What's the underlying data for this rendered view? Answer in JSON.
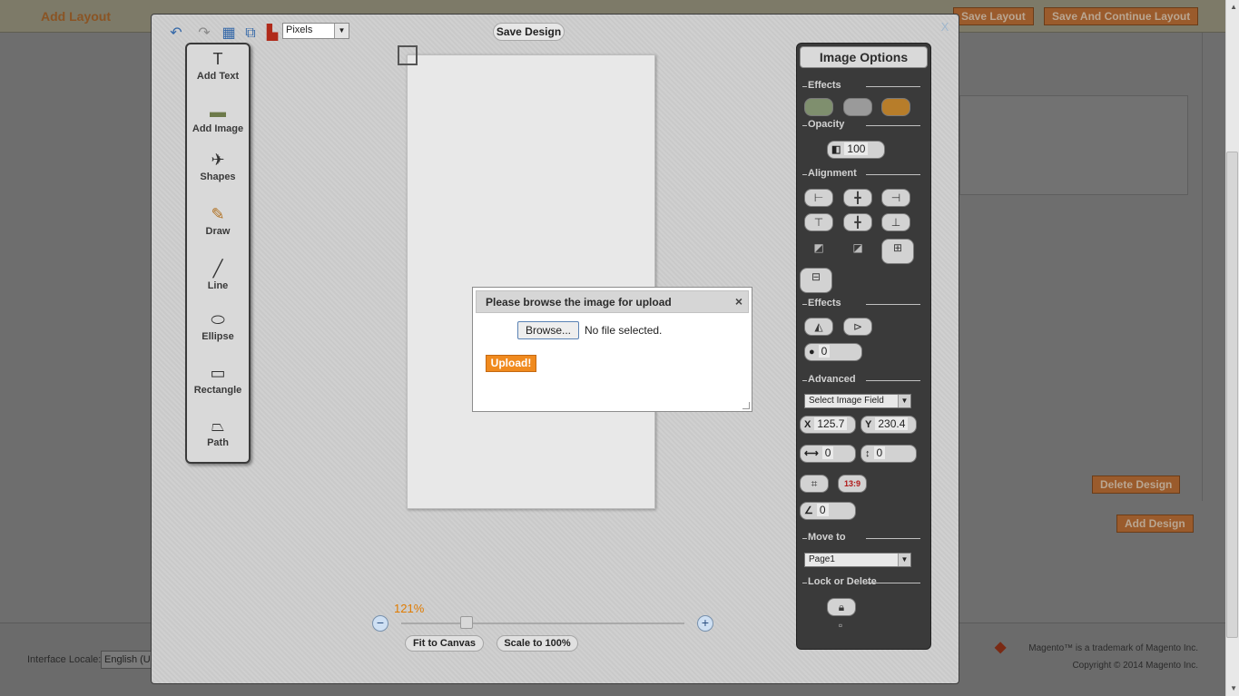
{
  "background": {
    "page_title": "Add Layout",
    "header_buttons": [
      "Save Layout",
      "Save And Continue Layout"
    ],
    "delete_design": "Delete Design",
    "add_design": "Add Design",
    "locale_label": "Interface Locale:",
    "locale_value": "English (U",
    "trademark": "Magento™ is a trademark of Magento Inc.",
    "copyright": "Copyright © 2014 Magento Inc."
  },
  "designer": {
    "close_label": "X",
    "unit_select": "Pixels",
    "save_design": "Save Design",
    "tools": [
      {
        "label": "Add Text",
        "icon": "text-tool-icon",
        "glyph": "T"
      },
      {
        "label": "Add Image",
        "icon": "image-tool-icon",
        "glyph": "▬"
      },
      {
        "label": "Shapes",
        "icon": "shapes-tool-icon",
        "glyph": "✈"
      },
      {
        "label": "Draw",
        "icon": "pencil-icon",
        "glyph": "✎"
      },
      {
        "label": "Line",
        "icon": "line-icon",
        "glyph": "╱"
      },
      {
        "label": "Ellipse",
        "icon": "ellipse-icon",
        "glyph": "⬭"
      },
      {
        "label": "Rectangle",
        "icon": "rectangle-icon",
        "glyph": "▭"
      },
      {
        "label": "Path",
        "icon": "path-icon",
        "glyph": "⏢"
      }
    ],
    "zoom": {
      "percent": "121%",
      "fit_label": "Fit to Canvas",
      "scale_label": "Scale to 100%"
    }
  },
  "options": {
    "title": "Image Options",
    "sections": {
      "effects": "Effects",
      "opacity": "Opacity",
      "alignment": "Alignment",
      "effects2": "Effects",
      "advanced": "Advanced",
      "move_to": "Move to",
      "lock_delete": "Lock or Delete"
    },
    "opacity_value": "100",
    "blur_value": "0",
    "image_field_select": "Select Image Field",
    "x_label": "X",
    "x_value": "125.7",
    "y_label": "Y",
    "y_value": "230.4",
    "width_value": "0",
    "height_value": "0",
    "ratio_label": "13:9",
    "angle_value": "0",
    "page_select": "Page1"
  },
  "upload": {
    "title": "Please browse the image for upload",
    "close": "×",
    "browse_label": "Browse...",
    "file_status": "No file selected.",
    "upload_label": "Upload!"
  },
  "colors": {
    "accent_orange": "#f08a1e",
    "panel_dark": "#3a3a3a",
    "link_blue": "#3367a8"
  }
}
